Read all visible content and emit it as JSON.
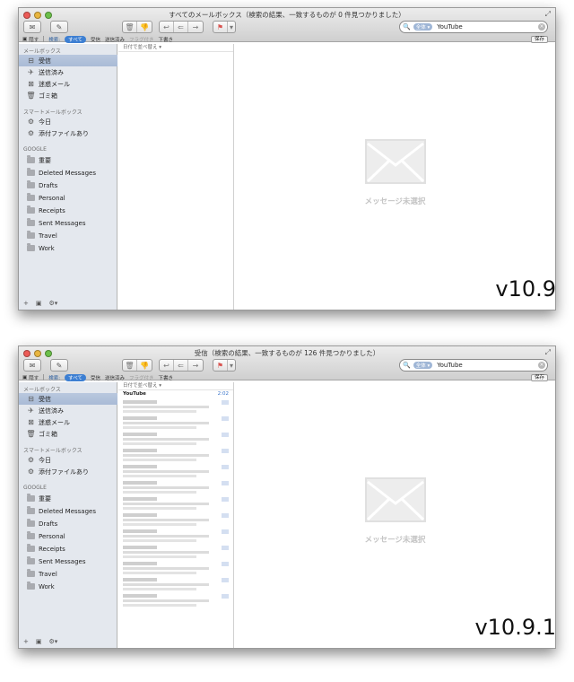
{
  "windows": [
    {
      "title": "すべてのメールボックス（検索の結果、一致するものが 0 件見つかりました）",
      "version": "v10.9",
      "show_results": false,
      "sort_label": "日付で並べ替え ▾"
    },
    {
      "title": "受信（検索の結果、一致するものが 126 件見つかりました）",
      "version": "v10.9.1",
      "show_results": true,
      "sort_label": "日付で並べ替え ▾",
      "first_result": {
        "sender": "YouTube",
        "date": "2:02"
      }
    }
  ],
  "search": {
    "token": "全体 ▾",
    "query": "YouTube"
  },
  "favbar": {
    "hide_label": "隠す",
    "search_label": "検索:",
    "scopes": [
      "すべて",
      "受信",
      "送信済み",
      "フラグ付き",
      "下書き"
    ],
    "save_label": "保存"
  },
  "sidebar": {
    "mailboxes_header": "メールボックス",
    "mailboxes": [
      {
        "label": "受信",
        "icon": "inbox-icon"
      },
      {
        "label": "送信済み",
        "icon": "paper-plane-icon"
      },
      {
        "label": "迷惑メール",
        "icon": "junk-icon"
      },
      {
        "label": "ゴミ箱",
        "icon": "trash-icon"
      }
    ],
    "smart_header": "スマートメールボックス",
    "smart": [
      {
        "label": "今日",
        "icon": "gear-icon"
      },
      {
        "label": "添付ファイルあり",
        "icon": "gear-icon"
      }
    ],
    "google_header": "GOOGLE",
    "google": [
      "重要",
      "Deleted Messages",
      "Drafts",
      "Personal",
      "Receipts",
      "Sent Messages",
      "Travel",
      "Work"
    ]
  },
  "content": {
    "empty_message": "メッセージ未選択"
  },
  "colors": {
    "accent": "#3d7fd2",
    "selection": "#b0c1da",
    "sidebar_bg": "#e4e8ee"
  }
}
